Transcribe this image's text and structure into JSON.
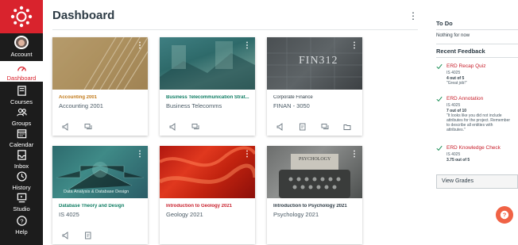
{
  "nav": {
    "account": "Account",
    "dashboard": "Dashboard",
    "courses": "Courses",
    "groups": "Groups",
    "calendar": "Calendar",
    "inbox": "Inbox",
    "history": "History",
    "studio": "Studio",
    "help": "Help"
  },
  "header": {
    "title": "Dashboard",
    "menu": "⋮"
  },
  "cards": [
    {
      "title": "Accounting 2001",
      "code": "Accounting 2001",
      "color": "#c27a1a"
    },
    {
      "title": "Business Telecommunication Strat...",
      "code": "Business Telecomms",
      "color": "#0f7d63"
    },
    {
      "title": "Corporate Finance",
      "code": "FINAN - 3050",
      "color": "#2d3b45",
      "hero_text": "FIN312"
    },
    {
      "title": "Database Theory and Design",
      "code": "IS 4025",
      "color": "#0f7d63",
      "hero_text": "Data Analysis & Database Design"
    },
    {
      "title": "Introduction to Geology 2021",
      "code": "Geology 2021",
      "color": "#c8202c"
    },
    {
      "title": "Introduction to Psychology 2021",
      "code": "Psychology 2021",
      "color": "#2d3b45",
      "hero_text": "PSYCHOLOGY"
    }
  ],
  "todo": {
    "title": "To Do",
    "empty": "Nothing for now"
  },
  "feedback": {
    "title": "Recent Feedback",
    "items": [
      {
        "title": "ERD Recap Quiz",
        "course": "IS 4025",
        "score": "4 out of 5",
        "comment": "\"Great job!\""
      },
      {
        "title": "ERD Annotation",
        "course": "IS 4025",
        "score": "7 out of 10",
        "comment_lines": [
          "\"It looks like you did not include",
          "attributes for the project. Remember",
          "to describe all entities with",
          "attributes.\""
        ]
      },
      {
        "title": "ERD Knowledge Check",
        "course": "IS 4025",
        "score": "3.75 out of 5"
      }
    ]
  },
  "view_grades": "View Grades",
  "colors": {
    "brand": "#d9232d",
    "nav_bg": "#1c1c1c",
    "help_fab": "#f06245",
    "feedback_link": "#c8202c",
    "check": "#0b874b"
  }
}
